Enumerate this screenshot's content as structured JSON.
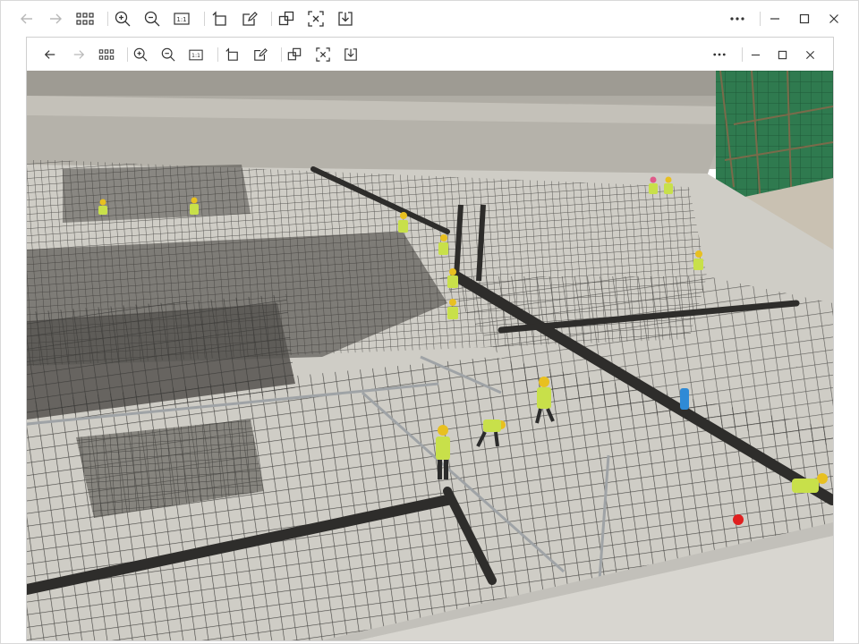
{
  "app": {
    "outer_toolbar": {
      "icons": [
        "back-arrow-icon",
        "forward-arrow-icon",
        "grid-icon",
        "zoom-in-icon",
        "zoom-out-icon",
        "actual-size-icon",
        "rotate-icon",
        "edit-icon",
        "copy-icon",
        "ocr-icon",
        "download-icon",
        "more-icon",
        "minimize-icon",
        "maximize-icon",
        "close-icon"
      ],
      "actual_size_label": "1:1"
    },
    "inner_toolbar": {
      "icons": [
        "back-arrow-icon",
        "forward-arrow-icon",
        "grid-icon",
        "zoom-in-icon",
        "zoom-out-icon",
        "actual-size-icon",
        "rotate-icon",
        "edit-icon",
        "copy-icon",
        "ocr-icon",
        "download-icon",
        "more-icon",
        "minimize-icon",
        "maximize-icon",
        "close-icon"
      ],
      "actual_size_label": "1:1"
    }
  },
  "photo": {
    "subject": "construction-site-rebar",
    "colors": {
      "wall": "#b9b6ad",
      "floor": "#cfcdc6",
      "rebar": "#3b3a38",
      "green_net": "#2f7a4f",
      "vest": "#c8e04a",
      "helmet": "#e8c020",
      "concrete_slab": "#d8d6d0"
    }
  }
}
